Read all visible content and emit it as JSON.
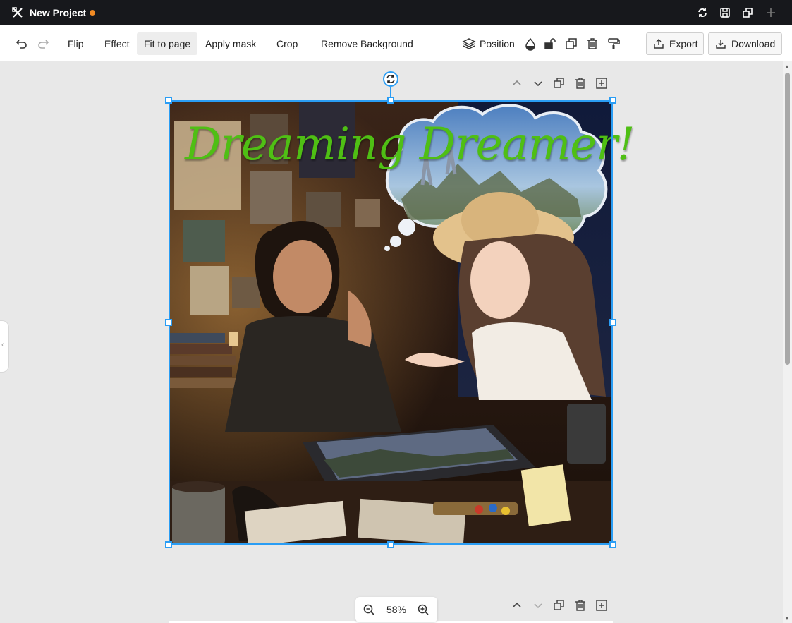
{
  "titlebar": {
    "project_title": "New Project",
    "unsaved_indicator_color": "#f08a24",
    "actions": [
      "refresh-icon",
      "save-icon",
      "duplicate-window-icon",
      "plus-icon"
    ]
  },
  "toolbar": {
    "undo_icon": "undo-icon",
    "redo_icon": "redo-icon",
    "flip": "Flip",
    "effect": "Effect",
    "fit_to_page": "Fit to page",
    "apply_mask": "Apply mask",
    "crop": "Crop",
    "remove_background": "Remove Background",
    "position": "Position",
    "export": "Export",
    "download": "Download"
  },
  "artwork": {
    "headline": "Dreaming Dreamer!",
    "selection_color": "#2a9df4",
    "headline_color": "#4fbf14"
  },
  "zoom": {
    "value": "58%"
  }
}
